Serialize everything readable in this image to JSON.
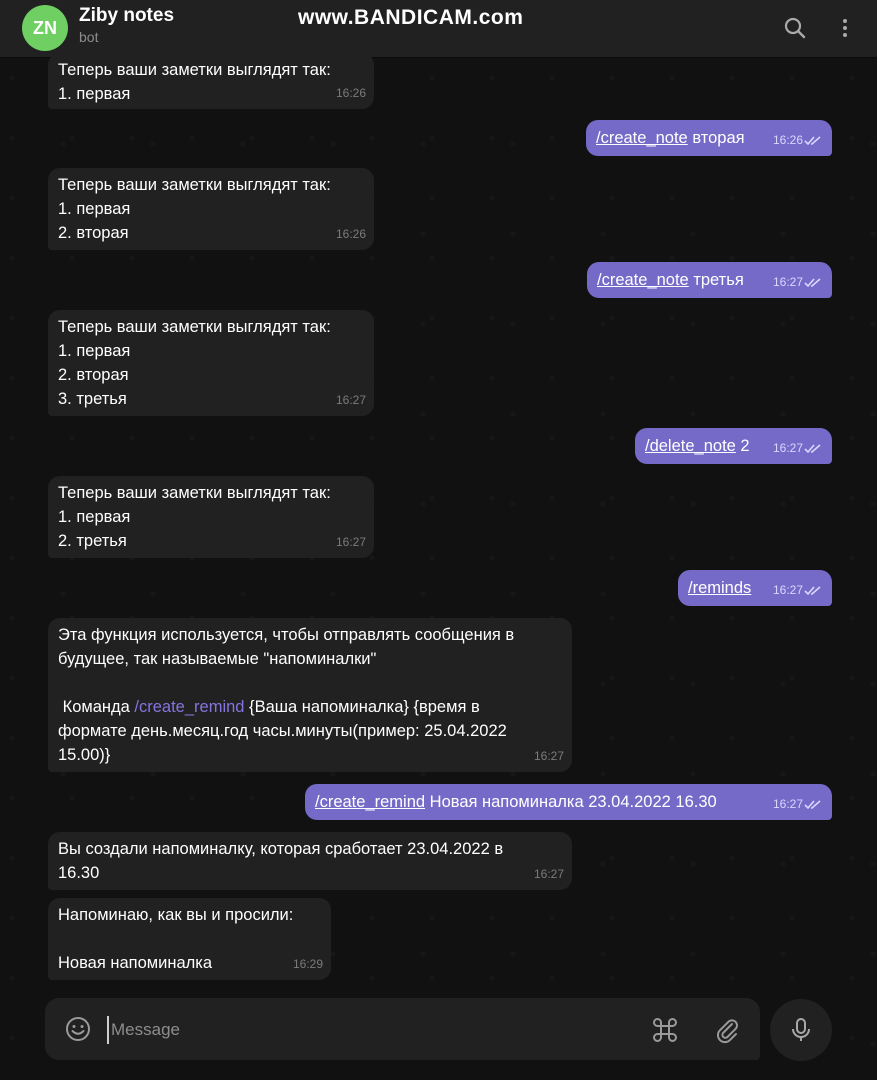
{
  "header": {
    "avatar_initials": "ZN",
    "title": "Ziby notes",
    "subtitle": "bot",
    "watermark": "www.BANDICAM.com",
    "search_icon": "search-icon",
    "more_icon": "more-vertical-icon"
  },
  "messages": [
    {
      "dir": "in",
      "lines": [
        "Теперь ваши заметки выглядят так:",
        "1. первая"
      ],
      "time": "16:26"
    },
    {
      "dir": "out",
      "cmd": "/create_note",
      "rest": " вторая",
      "time": "16:26"
    },
    {
      "dir": "in",
      "lines": [
        "Теперь ваши заметки выглядят так:",
        "1. первая",
        "2. вторая"
      ],
      "time": "16:26"
    },
    {
      "dir": "out",
      "cmd": "/create_note",
      "rest": " третья",
      "time": "16:27"
    },
    {
      "dir": "in",
      "lines": [
        "Теперь ваши заметки выглядят так:",
        "1. первая",
        "2. вторая",
        "3. третья"
      ],
      "time": "16:27"
    },
    {
      "dir": "out",
      "cmd": "/delete_note",
      "rest": " 2",
      "time": "16:27"
    },
    {
      "dir": "in",
      "lines": [
        "Теперь ваши заметки выглядят так:",
        "1. первая",
        "2. третья"
      ],
      "time": "16:27"
    },
    {
      "dir": "out",
      "cmd": "/reminds",
      "rest": "",
      "time": "16:27"
    },
    {
      "dir": "in",
      "lines": [
        "Эта функция используется, чтобы отправлять сообщения в",
        "будущее, так называемые \"напоминалки\"",
        "",
        " Команда "
      ],
      "cmd": "/create_remind",
      "after": " {Ваша напоминалка} {время в",
      "lines2": [
        "формате день.месяц.год часы.минуты(пример: 25.04.2022",
        "15.00)}"
      ],
      "time": "16:27"
    },
    {
      "dir": "out",
      "cmd": "/create_remind",
      "rest": " Новая напоминалка 23.04.2022 16.30",
      "time": "16:27"
    },
    {
      "dir": "in",
      "lines": [
        "Вы создали напоминалку, которая сработает 23.04.2022 в",
        "16.30"
      ],
      "time": "16:27"
    },
    {
      "dir": "in",
      "lines": [
        "Напоминаю, как вы и просили:",
        "",
        "Новая напоминалка"
      ],
      "time": "16:29"
    }
  ],
  "composer": {
    "placeholder": "Message",
    "emoji_icon": "emoji-icon",
    "command_icon": "command-icon",
    "attach_icon": "paperclip-icon",
    "mic_icon": "microphone-icon"
  },
  "colors": {
    "outgoing_bubble": "#766ac8",
    "incoming_bubble": "#212121",
    "avatar": "#6fcf63",
    "link_in_incoming": "#8774e1"
  }
}
